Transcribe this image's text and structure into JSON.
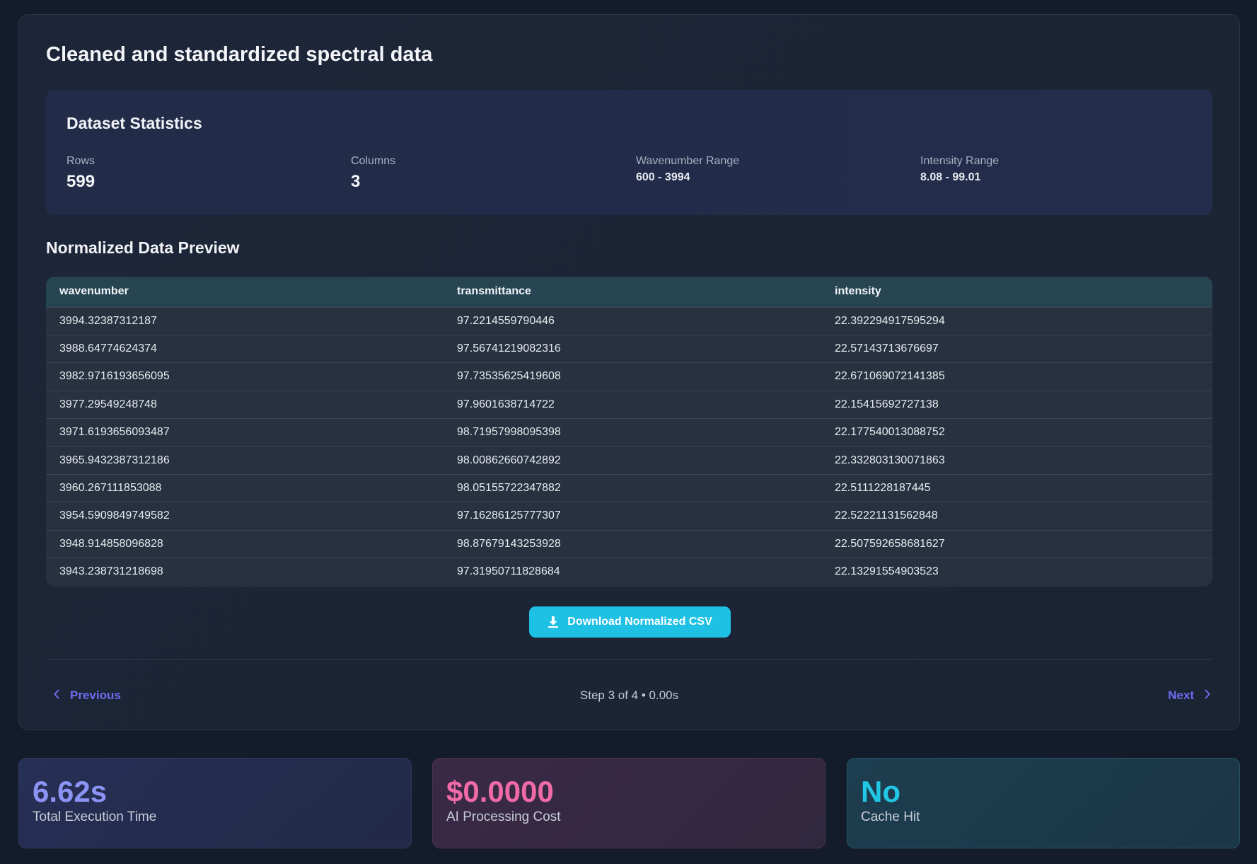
{
  "page": {
    "title": "Cleaned and standardized spectral data"
  },
  "stats": {
    "title": "Dataset Statistics",
    "rows_label": "Rows",
    "rows_value": "599",
    "columns_label": "Columns",
    "columns_value": "3",
    "wavenumber_label": "Wavenumber Range",
    "wavenumber_value": "600 - 3994",
    "intensity_label": "Intensity Range",
    "intensity_value": "8.08 - 99.01"
  },
  "preview": {
    "title": "Normalized Data Preview",
    "columns": [
      "wavenumber",
      "transmittance",
      "intensity"
    ],
    "rows": [
      [
        "3994.32387312187",
        "97.2214559790446",
        "22.392294917595294"
      ],
      [
        "3988.64774624374",
        "97.56741219082316",
        "22.57143713676697"
      ],
      [
        "3982.9716193656095",
        "97.73535625419608",
        "22.671069072141385"
      ],
      [
        "3977.29549248748",
        "97.9601638714722",
        "22.15415692727138"
      ],
      [
        "3971.6193656093487",
        "98.71957998095398",
        "22.177540013088752"
      ],
      [
        "3965.9432387312186",
        "98.00862660742892",
        "22.332803130071863"
      ],
      [
        "3960.267111853088",
        "98.05155722347882",
        "22.5111228187445"
      ],
      [
        "3954.5909849749582",
        "97.16286125777307",
        "22.52221131562848"
      ],
      [
        "3948.914858096828",
        "98.87679143253928",
        "22.507592658681627"
      ],
      [
        "3943.238731218698",
        "97.31950711828684",
        "22.13291554903523"
      ]
    ]
  },
  "actions": {
    "download_label": "Download Normalized CSV",
    "download_icon": "download-icon"
  },
  "nav": {
    "previous_label": "Previous",
    "next_label": "Next",
    "step_info": "Step 3 of 4 • 0.00s"
  },
  "metrics": {
    "execution_time_value": "6.62s",
    "execution_time_label": "Total Execution Time",
    "cost_value": "$0.0000",
    "cost_label": "AI Processing Cost",
    "cache_value": "No",
    "cache_label": "Cache Hit"
  },
  "colors": {
    "accent_cyan": "#1ec0e4",
    "nav_link": "#6d6cf0",
    "metric_time": "#8b93f5",
    "metric_cost": "#f06aa8",
    "metric_cache": "#22c7e6"
  }
}
